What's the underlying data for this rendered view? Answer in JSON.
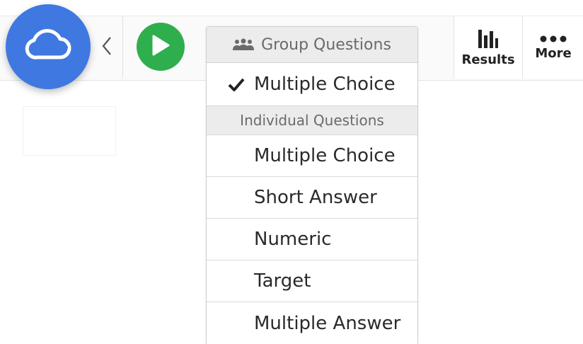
{
  "toolbar": {
    "results_label": "Results",
    "more_label": "More"
  },
  "dropdown": {
    "group_header": "Group Questions",
    "group_items": [
      {
        "label": "Multiple Choice",
        "selected": true
      }
    ],
    "individual_header": "Individual Questions",
    "individual_items": [
      {
        "label": "Multiple Choice"
      },
      {
        "label": "Short Answer"
      },
      {
        "label": "Numeric"
      },
      {
        "label": "Target"
      },
      {
        "label": "Multiple Answer"
      }
    ]
  },
  "icons": {
    "app": "cloud-icon",
    "back": "chevron-left-icon",
    "play": "play-icon",
    "group": "group-people-icon",
    "check": "checkmark-icon",
    "results": "bar-chart-icon",
    "more": "ellipsis-icon"
  },
  "colors": {
    "app_button": "#3f78e0",
    "play_button": "#2fae4e",
    "header_background": "#ececec"
  }
}
